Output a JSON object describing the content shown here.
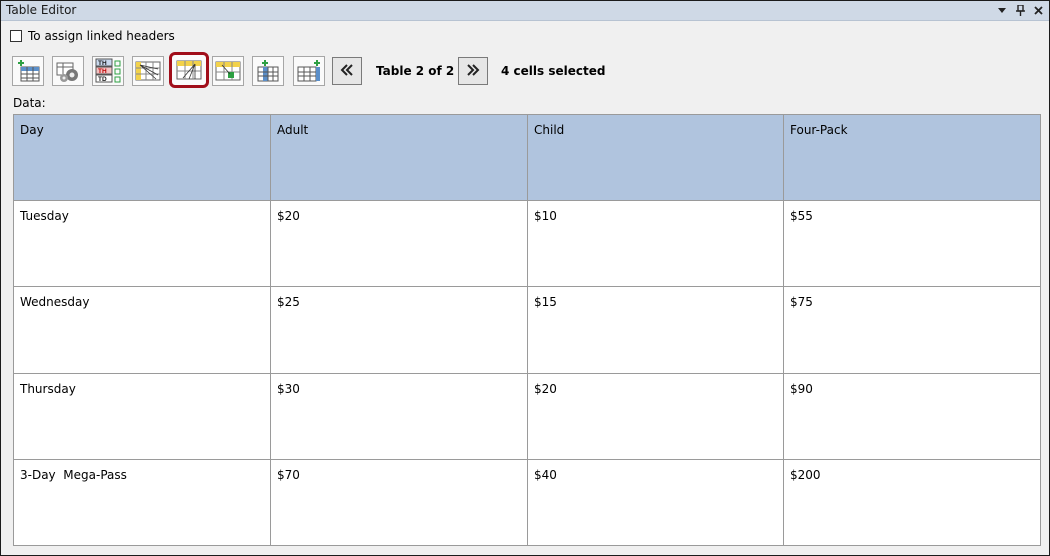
{
  "window": {
    "title": "Table Editor"
  },
  "options": {
    "assign_linked_headers_label": "To assign linked headers",
    "assign_linked_headers_checked": false
  },
  "toolbar": {
    "buttons": [
      {
        "icon": "insert-table-icon"
      },
      {
        "icon": "table-settings-icon"
      },
      {
        "icon": "header-data-cells-icon"
      },
      {
        "icon": "column-headers-icon"
      },
      {
        "icon": "row-headers-icon",
        "selected": true
      },
      {
        "icon": "assign-header-icon"
      },
      {
        "icon": "insert-column-icon"
      },
      {
        "icon": "insert-row-icon"
      }
    ],
    "table_position": "Table 2 of 2",
    "selection_status": "4 cells selected"
  },
  "data_section": {
    "label": "Data:",
    "headers": [
      "Day",
      "Adult",
      "Child",
      "Four-Pack"
    ],
    "rows": [
      [
        "Tuesday",
        "$20",
        "$10",
        "$55"
      ],
      [
        "Wednesday",
        "$25",
        "$15",
        "$75"
      ],
      [
        "Thursday",
        "$30",
        "$20",
        "$90"
      ],
      [
        "3-Day  Mega-Pass",
        "$70",
        "$40",
        "$200"
      ]
    ]
  }
}
